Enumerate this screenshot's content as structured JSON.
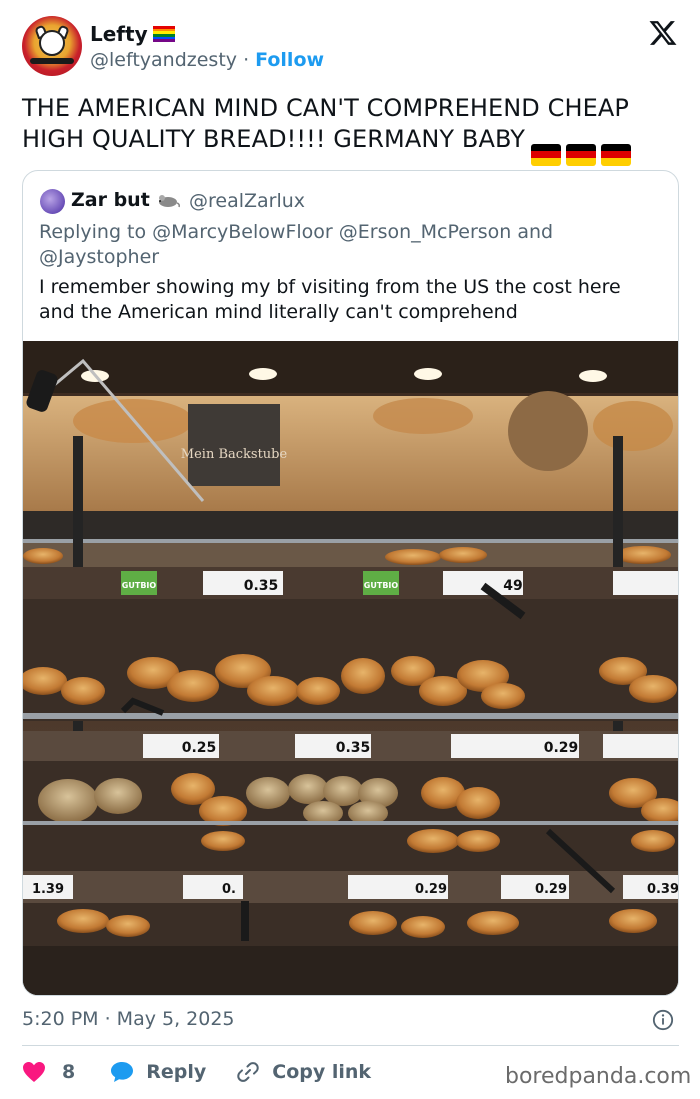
{
  "author": {
    "display_name": "Lefty",
    "handle": "@leftyandzesty",
    "separator": " · ",
    "follow_label": "Follow",
    "pride_flag_colors": [
      "#e40303",
      "#ff8c00",
      "#ffed00",
      "#008026",
      "#004dff",
      "#750787"
    ]
  },
  "tweet": {
    "text": "THE AMERICAN MIND CAN'T COMPREHEND CHEAP HIGH QUALITY BREAD!!!! GERMANY BABY",
    "flag_emoji": "german-flag",
    "flag_count": 3,
    "flag_colors": [
      "#000000",
      "#dd0000",
      "#ffce00"
    ]
  },
  "quoted": {
    "display_name": "Zar but",
    "badge_icon": "mouse-emoji",
    "handle": "@realZarlux",
    "reply_context": "Replying to @MarcyBelowFloor @Erson_McPerson and @Jaystopher",
    "text": "I remember showing my bf visiting from the US the cost here and the American mind literally can't comprehend",
    "photo": {
      "sign_text": "Mein Backstube",
      "brand_label": "GUTBIO",
      "prices": [
        "0.35",
        "49",
        "0.25",
        "0.35",
        "0.29",
        "1.39",
        "0.",
        "0.29",
        "0.29",
        "0.39"
      ]
    }
  },
  "meta": {
    "timestamp": "5:20 PM · May 5, 2025"
  },
  "actions": {
    "like_count": "8",
    "reply_label": "Reply",
    "copy_label": "Copy link"
  },
  "watermark": "boredpanda.com"
}
